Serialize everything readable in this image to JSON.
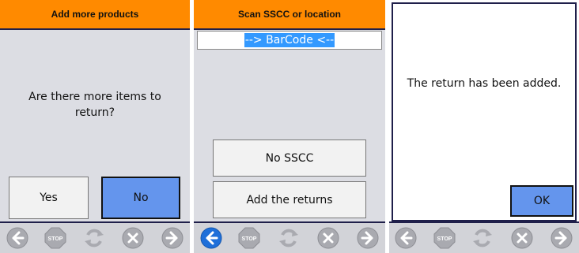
{
  "panel1": {
    "title": "Add more products",
    "message": "Are there more items to return?",
    "yes_label": "Yes",
    "no_label": "No"
  },
  "panel2": {
    "title": "Scan SSCC or location",
    "barcode_value": "--> BarCode <--",
    "no_sscc_label": "No SSCC",
    "add_returns_label": "Add the returns"
  },
  "panel3": {
    "message": "The return has been added.",
    "ok_label": "OK"
  },
  "toolbar": {
    "stop_label": "STOP",
    "icons": [
      "back-arrow-icon",
      "stop-icon",
      "refresh-icon",
      "cancel-icon",
      "forward-arrow-icon"
    ]
  },
  "colors": {
    "header": "#ff8a00",
    "accent_button": "#6495ed",
    "back_active": "#1e6fd9",
    "disabled_icon": "#a9aab0"
  }
}
